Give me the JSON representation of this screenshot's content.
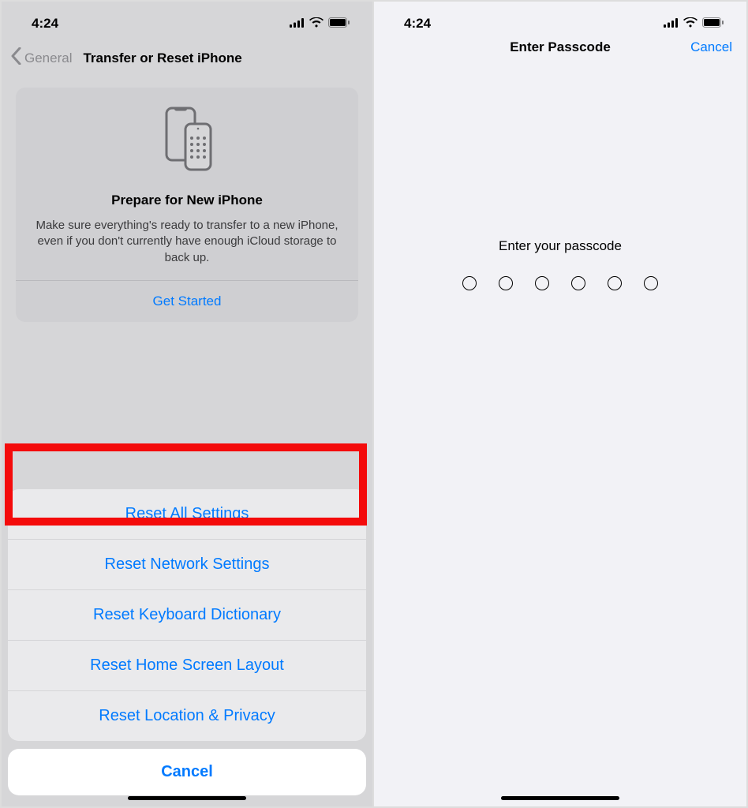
{
  "status": {
    "time": "4:24"
  },
  "left": {
    "nav": {
      "back_label": "General",
      "title": "Transfer or Reset iPhone"
    },
    "card": {
      "title": "Prepare for New iPhone",
      "desc": "Make sure everything's ready to transfer to a new iPhone, even if you don't currently have enough iCloud storage to back up.",
      "action": "Get Started"
    },
    "sheet": {
      "items": [
        "Reset All Settings",
        "Reset Network Settings",
        "Reset Keyboard Dictionary",
        "Reset Home Screen Layout",
        "Reset Location & Privacy"
      ],
      "cancel": "Cancel"
    }
  },
  "right": {
    "nav": {
      "title": "Enter Passcode",
      "cancel": "Cancel"
    },
    "prompt": "Enter your passcode",
    "digits": 6
  }
}
